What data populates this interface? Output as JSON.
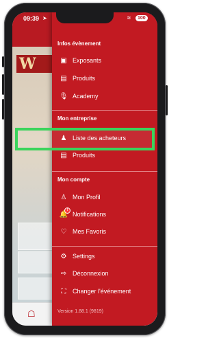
{
  "status_bar": {
    "time": "09:39",
    "battery": "100"
  },
  "drawer": {
    "sections": [
      {
        "title": "Infos évènement",
        "items": [
          {
            "label": "Exposants",
            "icon": "briefcase-icon"
          },
          {
            "label": "Produits",
            "icon": "bag-icon"
          },
          {
            "label": "Academy",
            "icon": "microphone-icon"
          }
        ]
      },
      {
        "title": "Mon entreprise",
        "items": [
          {
            "label": "Liste des acheteurs",
            "icon": "users-icon"
          },
          {
            "label": "Produits",
            "icon": "bag-icon"
          }
        ]
      },
      {
        "title": "Mon compte",
        "items": [
          {
            "label": "Mon Profil",
            "icon": "user-icon"
          },
          {
            "label": "Notifications",
            "icon": "bell-icon",
            "badge": "!"
          },
          {
            "label": "Mes Favoris",
            "icon": "user-heart-icon"
          }
        ]
      },
      {
        "title": "",
        "items": [
          {
            "label": "Settings",
            "icon": "gear-icon"
          },
          {
            "label": "Déconnexion",
            "icon": "logout-icon"
          },
          {
            "label": "Changer l'événement",
            "icon": "switch-event-icon"
          }
        ]
      }
    ],
    "version": "Version 1.88.1 (9819)"
  },
  "highlighted_item": "Liste des acheteurs",
  "colors": {
    "drawer_bg": "#c21a22",
    "highlight": "#3bd45c"
  }
}
